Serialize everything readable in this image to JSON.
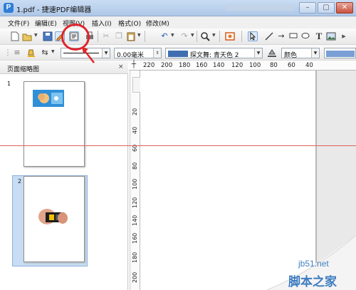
{
  "window": {
    "title": "1.pdf - 捷速PDF编辑器",
    "app_icon_letter": "P",
    "minimize_symbol": "–",
    "maximize_symbol": "▢",
    "close_symbol": "✕"
  },
  "menubar": {
    "items": [
      "文件(F)",
      "编辑(E)",
      "视图(V)",
      "插入(I)",
      "格式(O)",
      "修改(M)"
    ]
  },
  "toolbar": {
    "icons": [
      "new-document-icon",
      "open-folder-icon",
      "save-icon",
      "edit-pen-icon",
      "text-select-icon",
      "print-icon",
      "cut-icon",
      "copy-icon",
      "paste-icon",
      "undo-icon",
      "redo-icon",
      "zoom-icon",
      "page-layout-icon",
      "select-pointer-icon",
      "line-icon",
      "arrow-icon",
      "rectangle-icon",
      "ellipse-icon",
      "text-tool-icon",
      "image-icon"
    ],
    "text_tool_glyph": "T"
  },
  "format_toolbar": {
    "line_width_value": "0.00毫米",
    "line_style_value": "探文舞: 青天色 2",
    "fill_value": "颜色",
    "accent_color": "#3f6fb0"
  },
  "thumbnail_panel": {
    "title": "页面缩略图",
    "close_symbol": "×",
    "pages": [
      {
        "number": "1"
      },
      {
        "number": "2"
      }
    ]
  },
  "ruler": {
    "horizontal_labels": [
      "220",
      "200",
      "180",
      "160",
      "140",
      "120",
      "100",
      "80",
      "60",
      "40"
    ],
    "vertical_labels": [
      "20",
      "40",
      "60",
      "80",
      "100",
      "120",
      "140",
      "160",
      "180",
      "200"
    ]
  },
  "watermark": {
    "site": "jb51.net",
    "name": "脚本之家"
  },
  "colors": {
    "annotation_red": "#e0242b",
    "selection_blue": "#c8dcf3"
  }
}
